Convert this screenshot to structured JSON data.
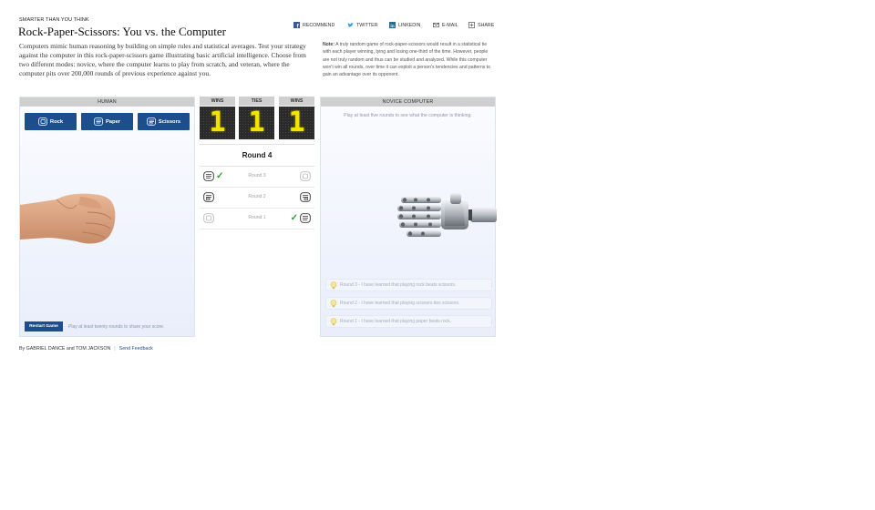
{
  "header": {
    "kicker": "SMARTER THAN YOU THINK",
    "title": "Rock-Paper-Scissors: You vs. the Computer",
    "intro": "Computers mimic human reasoning by building on simple rules and statistical averages. Test your strategy against the computer in this rock-paper-scissors game illustrating basic artificial intelligence. Choose from two different modes: novice, where the computer learns to play from scratch, and veteran, where the computer pits over 200,000 rounds of previous experience against you.",
    "note_label": "Note:",
    "note_text": "A truly random game of rock-paper-scissors would result in a statistical tie with each player winning, tying and losing one-third of the time. However, people are not truly random and thus can be studied and analyzed. While this computer won't win all rounds, over time it can exploit a person's tendencies and patterns to gain an advantage over its opponent."
  },
  "share": {
    "recommend": "RECOMMEND",
    "twitter": "TWITTER",
    "linkedin": "LINKEDIN",
    "email": "E-MAIL",
    "share": "SHARE"
  },
  "human": {
    "heading": "HUMAN",
    "buttons": [
      "Rock",
      "Paper",
      "Scissors"
    ],
    "restart": "Restart Game",
    "restart_note": "Play at least twenty rounds to share your score."
  },
  "scoreboard": {
    "human_wins_label": "WINS",
    "ties_label": "TIES",
    "computer_wins_label": "WINS",
    "human_wins": "1",
    "ties": "1",
    "computer_wins": "1",
    "current_round": "Round 4",
    "rounds": [
      {
        "label": "Round 3",
        "human_move": "paper",
        "computer_move": "rock",
        "winner": "human"
      },
      {
        "label": "Round 2",
        "human_move": "scissors",
        "computer_move": "scissors",
        "winner": "tie"
      },
      {
        "label": "Round 1",
        "human_move": "rock",
        "computer_move": "paper",
        "winner": "computer"
      }
    ]
  },
  "computer": {
    "heading": "NOVICE COMPUTER",
    "note": "Play at least five rounds to see what the computer is thinking.",
    "learned": [
      "Round 3 - I have learned that playing rock beats scissors.",
      "Round 2 - I have learned that playing scissors ties scissors.",
      "Round 1 - I have learned that playing paper beats rock."
    ]
  },
  "footer": {
    "byline": "By GABRIEL DANCE and TOM JACKSON",
    "feedback": "Send Feedback"
  }
}
